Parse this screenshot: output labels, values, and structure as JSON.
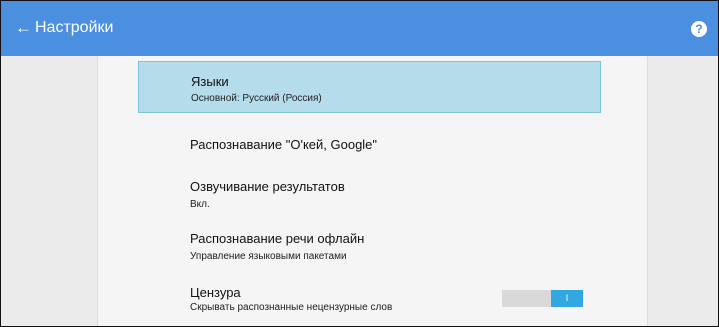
{
  "appbar": {
    "back_icon": "←",
    "title": "Настройки",
    "help_icon": "?"
  },
  "settings": {
    "languages": {
      "title": "Языки",
      "subtitle": "Основной: Русский (Россия)"
    },
    "ok_google": {
      "title": "Распознавание \"О'кей, Google\""
    },
    "voice_output": {
      "title": "Озвучивание результатов",
      "subtitle": "Вкл."
    },
    "offline": {
      "title": "Распознавание речи офлайн",
      "subtitle": "Управление языковыми пакетами"
    },
    "censorship": {
      "title": "Цензура",
      "subtitle": "Скрывать распознанные нецензурные слов",
      "toggle_state": "on",
      "toggle_thumb_label": "I"
    }
  },
  "colors": {
    "appbar": "#4a8fe0",
    "selected_row": "#b4dcea",
    "toggle_on": "#31a8df"
  }
}
